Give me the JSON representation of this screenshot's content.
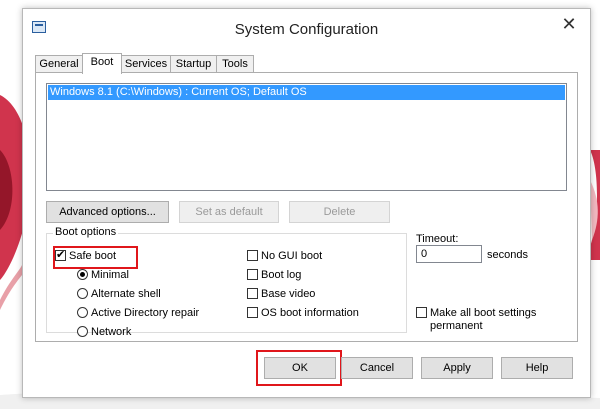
{
  "window": {
    "title": "System Configuration"
  },
  "tabs": [
    {
      "label": "General"
    },
    {
      "label": "Boot"
    },
    {
      "label": "Services"
    },
    {
      "label": "Startup"
    },
    {
      "label": "Tools"
    }
  ],
  "boot_list": {
    "selected_item": "Windows 8.1 (C:\\Windows) : Current OS; Default OS"
  },
  "buttons": {
    "advanced": "Advanced options...",
    "set_default": "Set as default",
    "delete": "Delete",
    "ok": "OK",
    "cancel": "Cancel",
    "apply": "Apply",
    "help": "Help"
  },
  "boot_options": {
    "label": "Boot options",
    "safe_boot": {
      "label": "Safe boot",
      "checked": true
    },
    "radios": [
      {
        "label": "Minimal",
        "checked": true
      },
      {
        "label": "Alternate shell",
        "checked": false
      },
      {
        "label": "Active Directory repair",
        "checked": false
      },
      {
        "label": "Network",
        "checked": false
      }
    ],
    "checks": [
      {
        "label": "No GUI boot",
        "checked": false
      },
      {
        "label": "Boot log",
        "checked": false
      },
      {
        "label": "Base video",
        "checked": false
      },
      {
        "label": "OS boot information",
        "checked": false
      }
    ]
  },
  "timeout": {
    "label": "Timeout:",
    "value": "0",
    "unit": "seconds"
  },
  "permanent": {
    "label_line1": "Make all boot settings",
    "label_line2": "permanent",
    "checked": false
  },
  "colors": {
    "highlight": "#e0161b",
    "selection": "#3399ff"
  }
}
